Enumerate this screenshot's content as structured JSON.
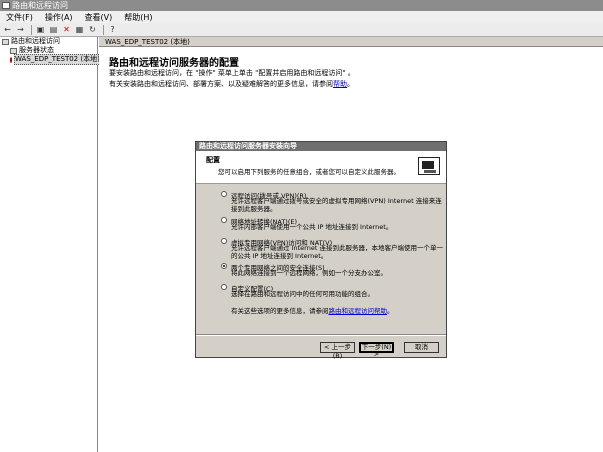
{
  "window": {
    "title": "路由和远程访问"
  },
  "menu": [
    "文件(F)",
    "操作(A)",
    "查看(V)",
    "帮助(H)"
  ],
  "toolbar": {
    "icons": [
      "back-icon",
      "forward-icon",
      "up-icon",
      "show-hide-tree-icon",
      "delete-icon",
      "properties-icon",
      "refresh-icon",
      "help-icon"
    ]
  },
  "tree": {
    "root": "路由和远程访问",
    "items": [
      "服务器状态",
      "WAS_EDP_TEST02 (本地)"
    ]
  },
  "main": {
    "header": "WAS_EDP_TEST02 (本地)",
    "title": "路由和远程访问服务器的配置",
    "line1": "要安装路由和远程访问，在 \"操作\" 菜单上单击 \"配置并启用路由和远程访问\" 。",
    "line2_prefix": "有关安装路由和远程访问、部署方案、以及疑难解答的更多信息，请参阅",
    "line2_link": "帮助",
    "line2_suffix": "。"
  },
  "dialog": {
    "title": "路由和远程访问服务器安装向导",
    "heading": "配置",
    "subheading": "您可以启用下列服务的任意组合，或者您可以自定义此服务器。",
    "options": [
      {
        "label": "远程访问(拨号或 VPN)(R)",
        "desc": "允许远程客户端通过拨号或安全的虚拟专用网络(VPN) Internet 连接来连接到此服务器。",
        "checked": false
      },
      {
        "label": "网络地址转换(NAT)(E)",
        "desc": "允许内部客户端使用一个公共 IP 地址连接到 Internet。",
        "checked": false
      },
      {
        "label": "虚拟专用网络(VPN)访问和 NAT(V)",
        "desc": "允许远程客户端通过 Internet 连接到此服务器，本地客户端使用一个单一的公共 IP 地址连接到 Internet。",
        "checked": false
      },
      {
        "label": "两个专用网络之间的安全连接(S)",
        "desc": "将此网络连接到一个远程网络，例如一个分支办公室。",
        "checked": true
      },
      {
        "label": "自定义配置(C)",
        "desc": "选择在路由和远程访问中的任何可用功能的组合。",
        "checked": false
      }
    ],
    "more_prefix": "有关这些选项的更多信息，请参阅",
    "more_link": "路由和远程访问帮助",
    "more_suffix": "。",
    "back_button": "< 上一步(B)",
    "next_button": "下一步(N) >",
    "cancel_button": "取消"
  }
}
